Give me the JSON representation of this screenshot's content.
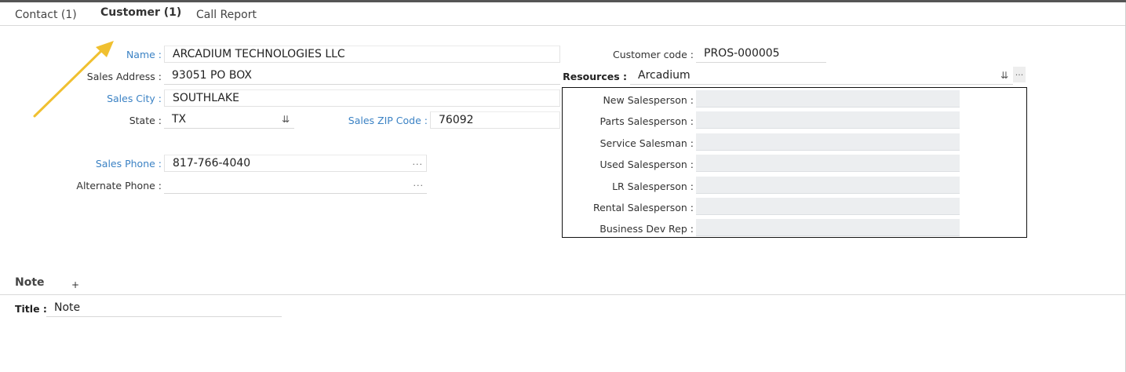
{
  "tabs": [
    {
      "label": "Contact (1)"
    },
    {
      "label": "Customer (1)"
    },
    {
      "label": "Call Report"
    }
  ],
  "form": {
    "name_label": "Name :",
    "name_value": "ARCADIUM TECHNOLOGIES LLC",
    "sales_address_label": "Sales Address :",
    "sales_address_value": "93051 PO BOX",
    "sales_city_label": "Sales City :",
    "sales_city_value": "SOUTHLAKE",
    "state_label": "State :",
    "state_value": "TX",
    "sales_zip_label": "Sales ZIP Code :",
    "sales_zip_value": "76092",
    "sales_phone_label": "Sales Phone :",
    "sales_phone_value": "817-766-4040",
    "alternate_phone_label": "Alternate Phone :",
    "alternate_phone_value": "",
    "customer_code_label": "Customer code :",
    "customer_code_value": "PROS-000005",
    "resources_label": "Resources :",
    "resources_value": "Arcadium",
    "ellipsis": "..."
  },
  "resources_box": {
    "rows": [
      {
        "label": "New Salesperson :",
        "value": ""
      },
      {
        "label": "Parts Salesperson :",
        "value": ""
      },
      {
        "label": "Service Salesman :",
        "value": ""
      },
      {
        "label": "Used Salesperson :",
        "value": ""
      },
      {
        "label": "LR Salesperson :",
        "value": ""
      },
      {
        "label": "Rental Salesperson :",
        "value": ""
      },
      {
        "label": "Business Dev Rep :",
        "value": ""
      }
    ]
  },
  "note": {
    "section_title": "Note",
    "add_label": "+",
    "title_label": "Title :",
    "title_value": "Note"
  },
  "icons": {
    "dropdown": "double-chevron-down-icon",
    "annotation_arrow_color": "#f0c030"
  },
  "colors": {
    "required_label": "#3b82c4",
    "top_border": "#555555"
  }
}
